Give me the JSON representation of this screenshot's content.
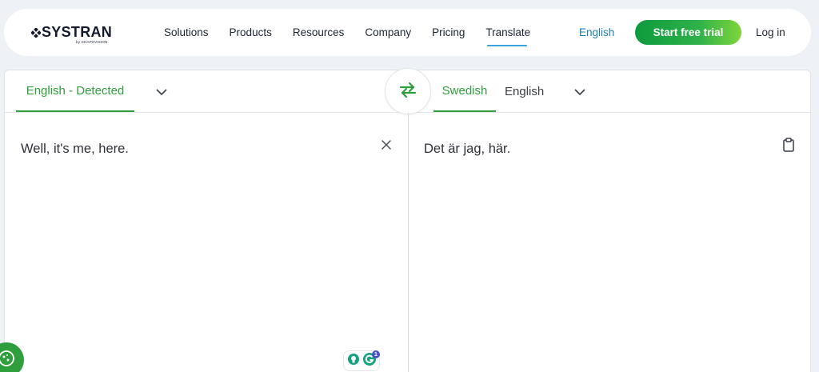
{
  "header": {
    "logo_text": "SYSTRAN",
    "logo_sub": "by CHAPSVISION",
    "nav": [
      "Solutions",
      "Products",
      "Resources",
      "Company",
      "Pricing",
      "Translate"
    ],
    "active_nav": "Translate",
    "language_link": "English",
    "trial_button": "Start free trial",
    "login_link": "Log in"
  },
  "translator": {
    "source_language": "English - Detected",
    "target_language_active": "Swedish",
    "target_language_other": "English",
    "source_text": "Well, it's me, here.",
    "target_text": "Det är jag, här."
  },
  "grammarly": {
    "badge_count": "1"
  },
  "colors": {
    "accent_green": "#2f9e3d",
    "link_blue": "#1b7fb8",
    "trial_gradient_start": "#0d9b3e",
    "trial_gradient_end": "#7fd63b"
  }
}
